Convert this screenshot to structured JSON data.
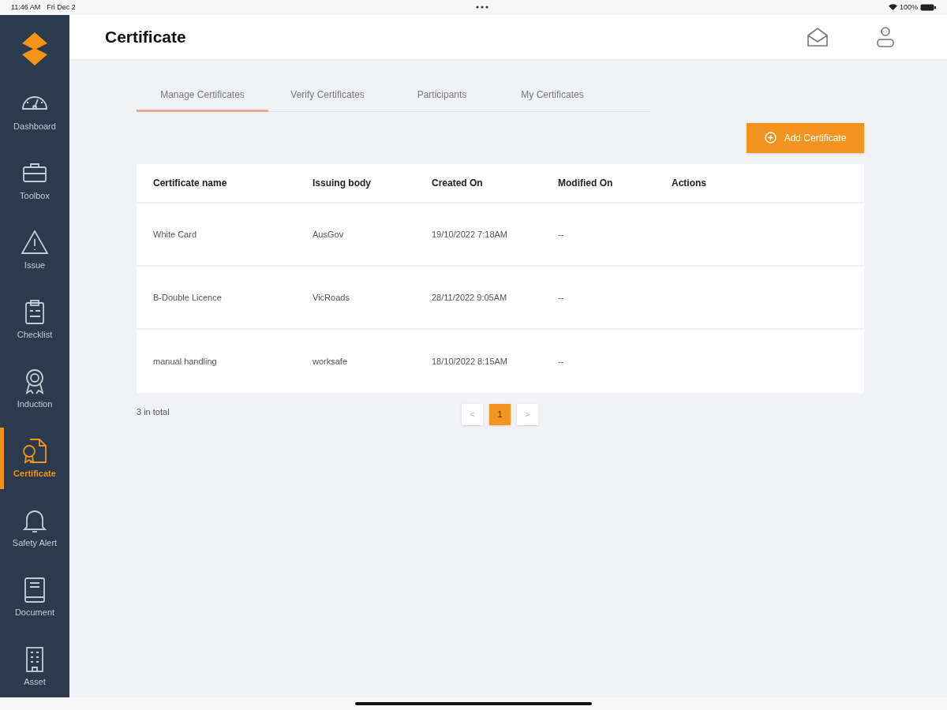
{
  "status_bar": {
    "time": "11:46 AM",
    "date": "Fri Dec 2",
    "battery": "100%"
  },
  "sidebar": {
    "items": [
      {
        "label": "Dashboard",
        "selected": false
      },
      {
        "label": "Toolbox",
        "selected": false
      },
      {
        "label": "Issue",
        "selected": false
      },
      {
        "label": "Checklist",
        "selected": false
      },
      {
        "label": "Induction",
        "selected": false
      },
      {
        "label": "Certificate",
        "selected": true
      },
      {
        "label": "Safety Alert",
        "selected": false
      },
      {
        "label": "Document",
        "selected": false
      },
      {
        "label": "Asset",
        "selected": false
      }
    ]
  },
  "header": {
    "title": "Certificate"
  },
  "tabs": [
    {
      "label": "Manage Certificates",
      "selected": true
    },
    {
      "label": "Verify Certificates",
      "selected": false
    },
    {
      "label": "Participants",
      "selected": false
    },
    {
      "label": "My Certificates",
      "selected": false
    }
  ],
  "add_button": "Add Certificate",
  "table": {
    "columns": [
      "Certificate name",
      "Issuing body",
      "Created On",
      "Modified On",
      "Actions"
    ],
    "rows": [
      [
        "White Card",
        "AusGov",
        "19/10/2022 7:18AM",
        "--"
      ],
      [
        "B-Double Licence",
        "VicRoads",
        "28/11/2022 9:05AM",
        "--"
      ],
      [
        "manual handling",
        "worksafe",
        "18/10/2022 8:15AM",
        "--"
      ]
    ]
  },
  "total": "3 in total",
  "pagination": {
    "prev": "<",
    "pages": [
      {
        "label": "1",
        "selected": true
      }
    ],
    "next": ">"
  }
}
